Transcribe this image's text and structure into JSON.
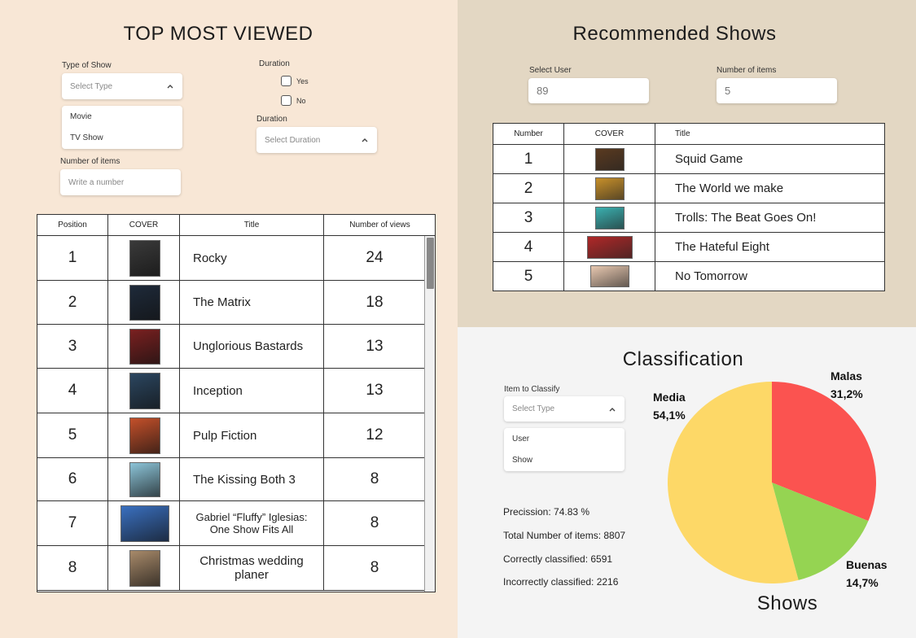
{
  "top": {
    "title": "TOP MOST VIEWED",
    "type_label": "Type of Show",
    "type_placeholder": "Select Type",
    "type_options": [
      "Movie",
      "TV Show"
    ],
    "duration_label": "Duration",
    "yes": "Yes",
    "no": "No",
    "duration_select_label": "Duration",
    "duration_placeholder": "Select Duration",
    "items_label": "Number of items",
    "items_placeholder": "Write a number",
    "headers": [
      "Position",
      "COVER",
      "Title",
      "Number of views"
    ],
    "rows": [
      {
        "pos": "1",
        "title": "Rocky",
        "views": "24",
        "cover": "#3a3a3a"
      },
      {
        "pos": "2",
        "title": "The Matrix",
        "views": "18",
        "cover": "#1e2a3a"
      },
      {
        "pos": "3",
        "title": "Unglorious Bastards",
        "views": "13",
        "cover": "#7a2020"
      },
      {
        "pos": "4",
        "title": "Inception",
        "views": "13",
        "cover": "#2b4660"
      },
      {
        "pos": "5",
        "title": "Pulp Fiction",
        "views": "12",
        "cover": "#c4502a"
      },
      {
        "pos": "6",
        "title": "The Kissing Both 3",
        "views": "8",
        "cover": "#8cc4d8"
      },
      {
        "pos": "7",
        "title": "Gabriel “Fluffy” Iglesias:\nOne Show Fits All",
        "views": "8",
        "cover": "#3a70c0"
      },
      {
        "pos": "8",
        "title": "Christmas wedding\nplaner",
        "views": "8",
        "cover": "#a88a6a"
      }
    ]
  },
  "rec": {
    "title": "Recommended Shows",
    "user_label": "Select User",
    "user_value": "89",
    "items_label": "Number of items",
    "items_value": "5",
    "headers": [
      "Number",
      "COVER",
      "Title"
    ],
    "rows": [
      {
        "num": "1",
        "title": "Squid Game",
        "cover": "#5a3a20"
      },
      {
        "num": "2",
        "title": "The World we make",
        "cover": "#c8902a"
      },
      {
        "num": "3",
        "title": "Trolls: The Beat Goes On!",
        "cover": "#3ab0b0"
      },
      {
        "num": "4",
        "title": "The Hateful Eight",
        "cover": "#b02828"
      },
      {
        "num": "5",
        "title": "No Tomorrow",
        "cover": "#e8c8b0"
      }
    ]
  },
  "cls": {
    "title": "Classification",
    "item_label": "Item to Classify",
    "item_placeholder": "Select Type",
    "item_options": [
      "User",
      "Show"
    ],
    "precision": "Precission:   74.83 %",
    "total": "Total Number of items:  8807",
    "correct": "Correctly classified: 6591",
    "incorrect": "Incorrectly classified: 2216",
    "chart_caption": "Shows"
  },
  "chart_data": {
    "type": "pie",
    "labels": [
      "Malas",
      "Buenas",
      "Media"
    ],
    "values": [
      31.2,
      14.7,
      54.1
    ],
    "display": [
      "31,2%",
      "14,7%",
      "54,1%"
    ],
    "colors": [
      "#fb5350",
      "#95d452",
      "#fdd867"
    ]
  }
}
